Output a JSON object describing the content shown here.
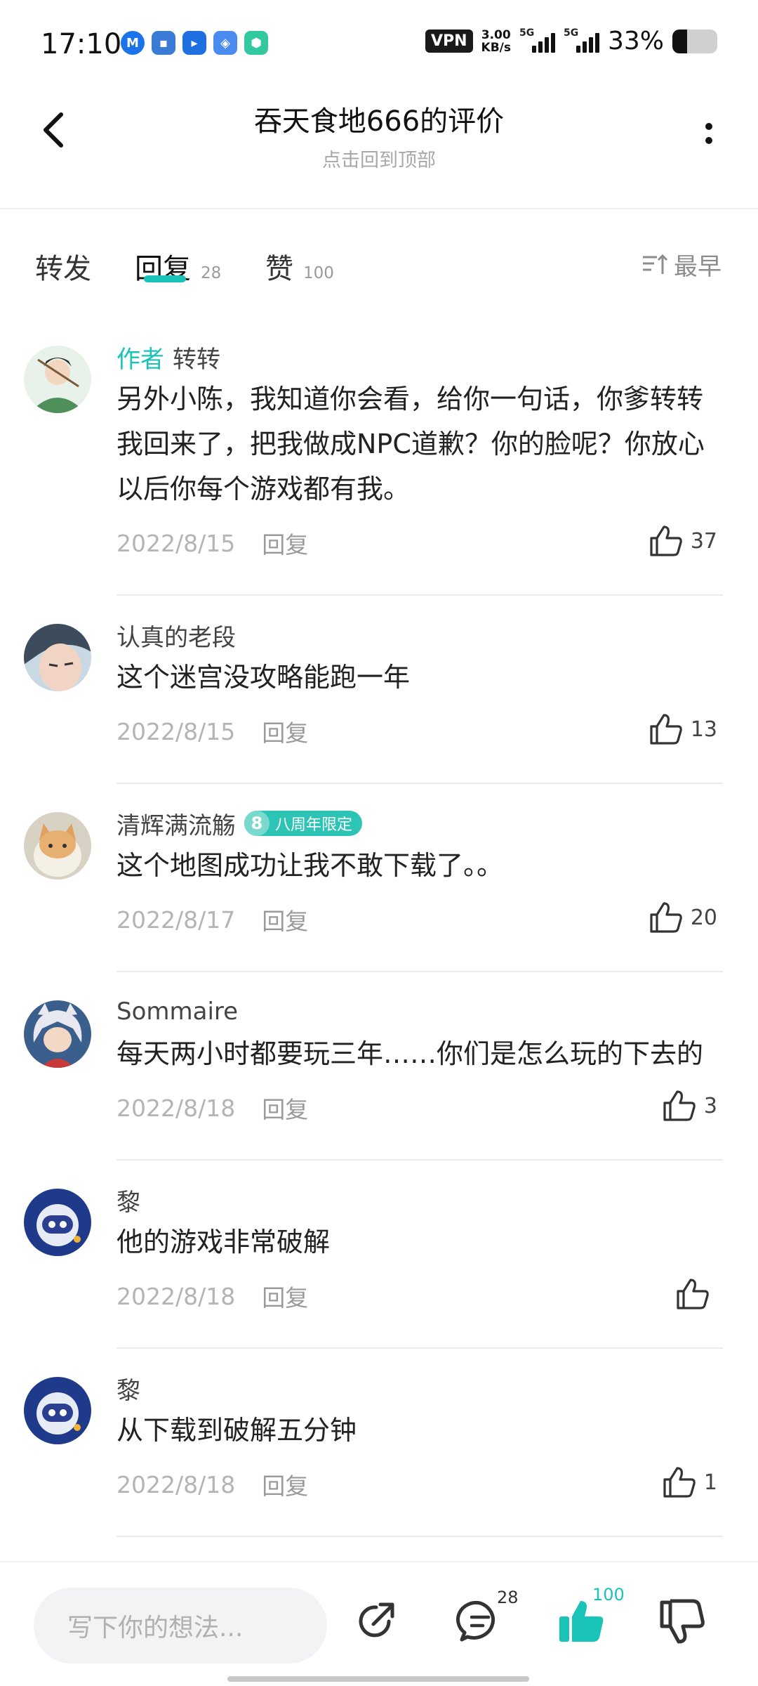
{
  "status_bar": {
    "time": "17:10",
    "vpn": "VPN",
    "speed_value": "3.00",
    "speed_unit": "KB/s",
    "signal1_tag": "5G",
    "signal2_tag": "5G",
    "battery_percent": "33%",
    "battery_level": 0.33,
    "app_icons": [
      "meituan-icon",
      "app-icon",
      "bilibili-icon",
      "app-icon",
      "security-icon"
    ]
  },
  "header": {
    "title": "吞天食地666的评价",
    "subtitle": "点击回到顶部"
  },
  "tabs": {
    "forward_label": "转发",
    "reply_label": "回复",
    "reply_count": "28",
    "like_label": "赞",
    "like_count": "100",
    "sort_label": "最早"
  },
  "comments": [
    {
      "author_tag": "作者",
      "name": "转转",
      "text": "另外小陈，我知道你会看，给你一句话，你爹转转我回来了，把我做成NPC道歉？你的脸呢？你放心以后你每个游戏都有我。",
      "date": "2022/8/15",
      "reply_label": "回复",
      "likes": "37",
      "avatar": "avatar-ancient-costume"
    },
    {
      "name": "认真的老段",
      "text": "这个迷宫没攻略能跑一年",
      "date": "2022/8/15",
      "reply_label": "回复",
      "likes": "13",
      "avatar": "avatar-anime-face"
    },
    {
      "name": "清辉满流觞",
      "badge_num": "8",
      "badge_text": "八周年限定",
      "text": "这个地图成功让我不敢下载了。。",
      "date": "2022/8/17",
      "reply_label": "回复",
      "likes": "20",
      "avatar": "avatar-cat"
    },
    {
      "name": "Sommaire",
      "text": "每天两小时都要玩三年……你们是怎么玩的下去的",
      "date": "2022/8/18",
      "reply_label": "回复",
      "likes": "3",
      "avatar": "avatar-anime-character"
    },
    {
      "name": "黎",
      "text": "他的游戏非常破解",
      "date": "2022/8/18",
      "reply_label": "回复",
      "likes": "",
      "avatar": "avatar-robot"
    },
    {
      "name": "黎",
      "text": "从下载到破解五分钟",
      "date": "2022/8/18",
      "reply_label": "回复",
      "likes": "1",
      "avatar": "avatar-robot"
    }
  ],
  "bottom_bar": {
    "input_placeholder": "写下你的想法...",
    "comment_count": "28",
    "like_count": "100",
    "accent_color": "#19c3b7"
  }
}
